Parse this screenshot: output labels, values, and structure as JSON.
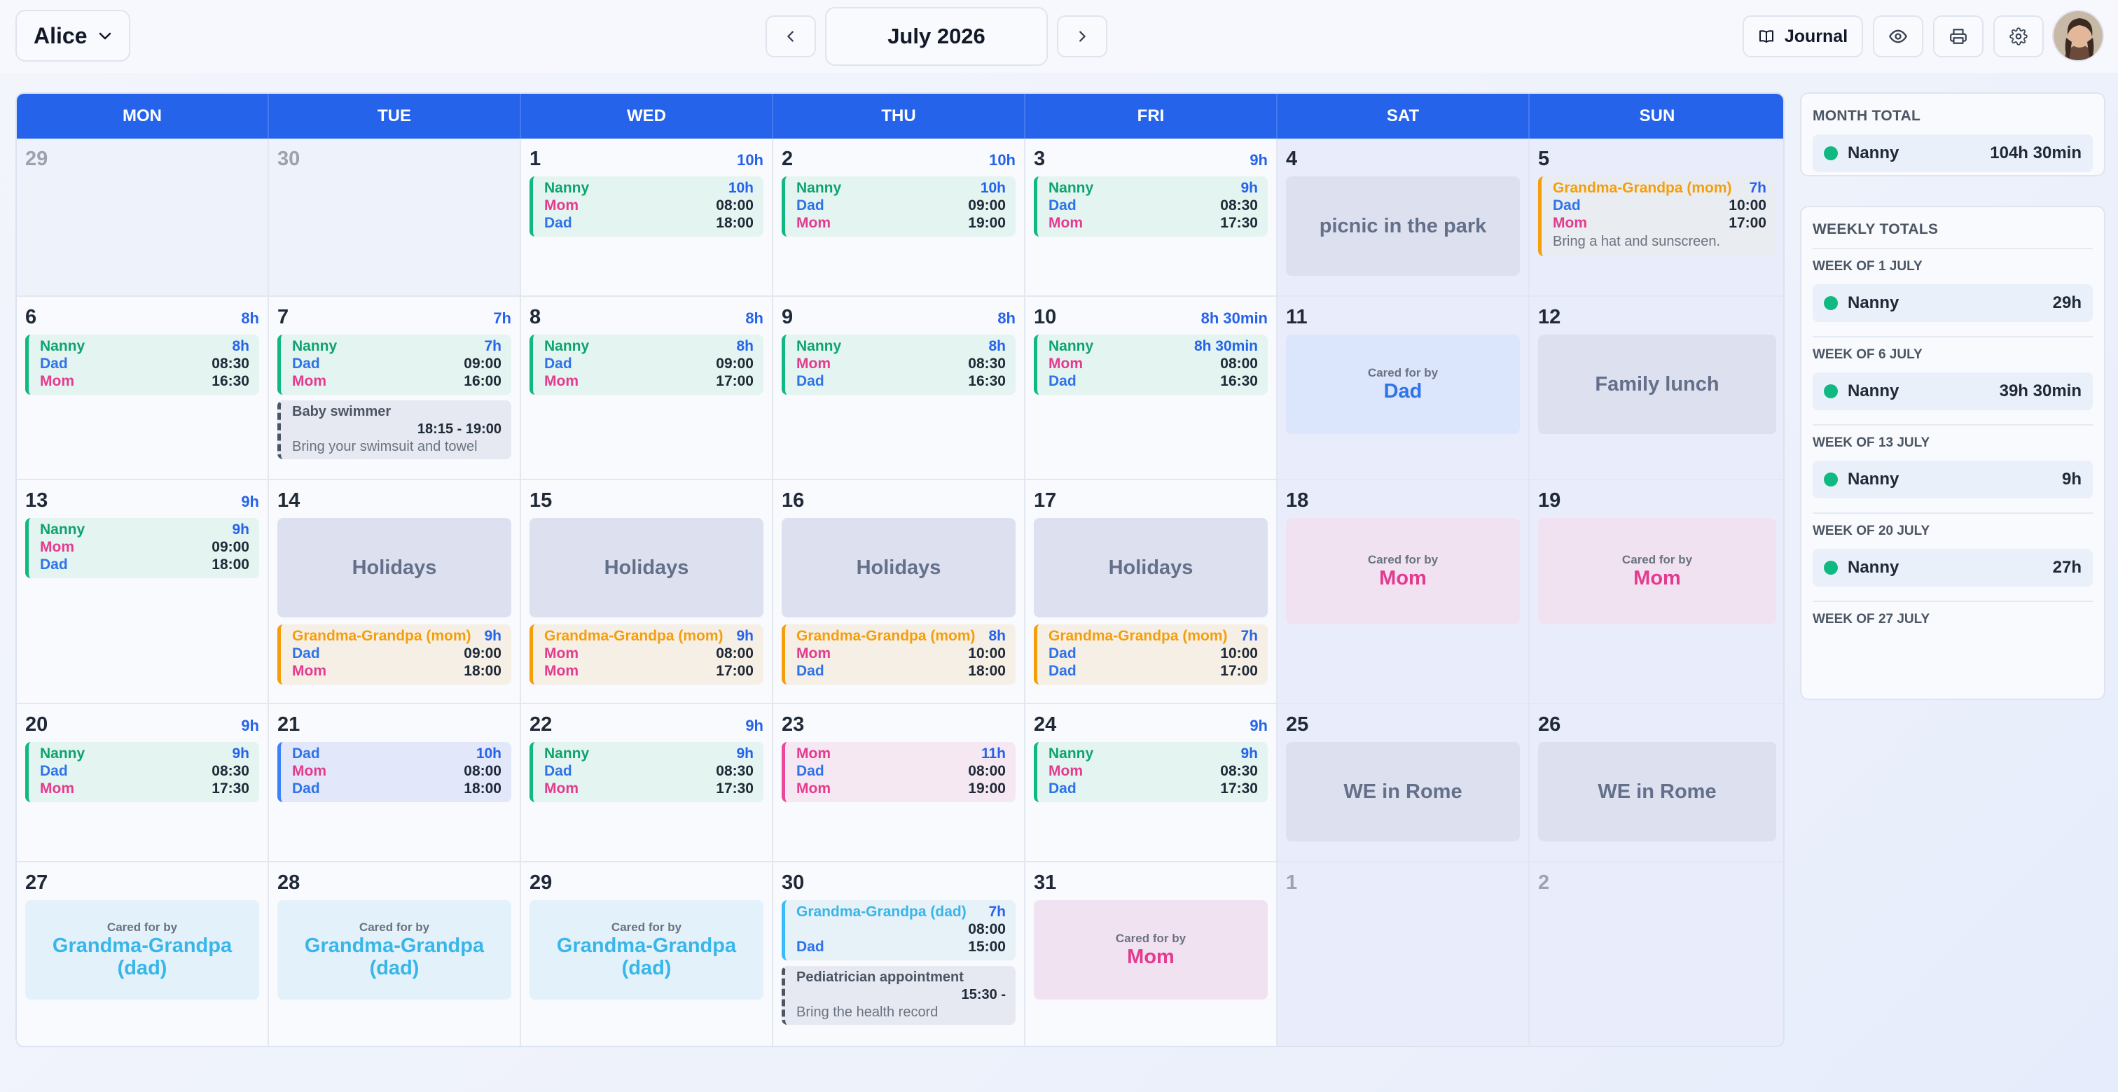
{
  "user": "Alice",
  "month": "July 2026",
  "toolbar": {
    "journal": "Journal"
  },
  "weekdays": [
    "MON",
    "TUE",
    "WED",
    "THU",
    "FRI",
    "SAT",
    "SUN"
  ],
  "days": {
    "d29p": {
      "n": "29"
    },
    "d30p": {
      "n": "30"
    },
    "d1": {
      "n": "1",
      "h": "10h"
    },
    "d2": {
      "n": "2",
      "h": "10h"
    },
    "d3": {
      "n": "3",
      "h": "9h"
    },
    "d4": {
      "n": "4"
    },
    "d5": {
      "n": "5"
    },
    "d6": {
      "n": "6",
      "h": "8h"
    },
    "d7": {
      "n": "7",
      "h": "7h"
    },
    "d8": {
      "n": "8",
      "h": "8h"
    },
    "d9": {
      "n": "9",
      "h": "8h"
    },
    "d10": {
      "n": "10",
      "h": "8h 30min"
    },
    "d11": {
      "n": "11"
    },
    "d12": {
      "n": "12"
    },
    "d13": {
      "n": "13",
      "h": "9h"
    },
    "d14": {
      "n": "14"
    },
    "d15": {
      "n": "15"
    },
    "d16": {
      "n": "16"
    },
    "d17": {
      "n": "17"
    },
    "d18": {
      "n": "18"
    },
    "d19": {
      "n": "19"
    },
    "d20": {
      "n": "20",
      "h": "9h"
    },
    "d21": {
      "n": "21"
    },
    "d22": {
      "n": "22",
      "h": "9h"
    },
    "d23": {
      "n": "23"
    },
    "d24": {
      "n": "24",
      "h": "9h"
    },
    "d25": {
      "n": "25"
    },
    "d26": {
      "n": "26"
    },
    "d27": {
      "n": "27"
    },
    "d28": {
      "n": "28"
    },
    "d29": {
      "n": "29"
    },
    "d30": {
      "n": "30"
    },
    "d31": {
      "n": "31"
    },
    "d1n": {
      "n": "1"
    },
    "d2n": {
      "n": "2"
    }
  },
  "labels": {
    "nanny": "Nanny",
    "dad": "Dad",
    "mom": "Mom",
    "gm": "Grandma-Grandpa (mom)",
    "gd": "Grandma-Grandpa (dad)",
    "cared": "Cared for by",
    "holidays": "Holidays",
    "picnic": "picnic in the park",
    "lunch": "Family lunch",
    "rome": "WE in Rome"
  },
  "events": {
    "e1": {
      "h": "10h",
      "a": "08:00",
      "b": "18:00"
    },
    "e2": {
      "h": "10h",
      "a": "09:00",
      "b": "19:00"
    },
    "e3": {
      "h": "9h",
      "a": "08:30",
      "b": "17:30"
    },
    "e5": {
      "h": "7h",
      "a": "10:00",
      "b": "17:00",
      "note": "Bring a hat and sunscreen."
    },
    "e6": {
      "h": "8h",
      "a": "08:30",
      "b": "16:30"
    },
    "e7": {
      "h": "7h",
      "a": "09:00",
      "b": "16:00"
    },
    "a7": {
      "title": "Baby swimmer",
      "time": "18:15 - 19:00",
      "note": "Bring your swimsuit and towel"
    },
    "e8": {
      "h": "8h",
      "a": "09:00",
      "b": "17:00"
    },
    "e9": {
      "h": "8h",
      "a": "08:30",
      "b": "16:30"
    },
    "e10": {
      "h": "8h 30min",
      "a": "08:00",
      "b": "16:30"
    },
    "e13": {
      "h": "9h",
      "a": "09:00",
      "b": "18:00"
    },
    "e14": {
      "h": "9h",
      "a": "09:00",
      "b": "18:00"
    },
    "e15": {
      "h": "9h",
      "a": "08:00",
      "b": "17:00"
    },
    "e16": {
      "h": "8h",
      "a": "10:00",
      "b": "18:00"
    },
    "e17": {
      "h": "7h",
      "a": "10:00",
      "b": "17:00"
    },
    "e20": {
      "h": "9h",
      "a": "08:30",
      "b": "17:30"
    },
    "e21": {
      "h": "10h",
      "a": "08:00",
      "b": "18:00"
    },
    "e22": {
      "h": "9h",
      "a": "08:30",
      "b": "17:30"
    },
    "e23": {
      "h": "11h",
      "a": "08:00",
      "b": "19:00"
    },
    "e24": {
      "h": "9h",
      "a": "08:30",
      "b": "17:30"
    },
    "e30": {
      "h": "7h",
      "a": "08:00",
      "b": "15:00"
    },
    "a30": {
      "title": "Pediatrician appointment",
      "time": "15:30 -",
      "note": "Bring the health record"
    }
  },
  "sidebar": {
    "month_title": "MONTH TOTAL",
    "month_row": {
      "name": "Nanny",
      "value": "104h 30min"
    },
    "weekly_title": "WEEKLY TOTALS",
    "weeks": [
      {
        "title": "WEEK OF 1 JULY",
        "name": "Nanny",
        "value": "29h"
      },
      {
        "title": "WEEK OF 6 JULY",
        "name": "Nanny",
        "value": "39h 30min"
      },
      {
        "title": "WEEK OF 13 JULY",
        "name": "Nanny",
        "value": "9h"
      },
      {
        "title": "WEEK OF 20 JULY",
        "name": "Nanny",
        "value": "27h"
      },
      {
        "title": "WEEK OF 27 JULY"
      }
    ]
  },
  "colors": {
    "accent": "#2563eb",
    "nanny": "#10b981",
    "dad": "#2f73e8",
    "mom": "#e33b8e",
    "grandma_grandpa_mom": "#f59e0b",
    "grandma_grandpa_dad": "#38b6e8"
  }
}
